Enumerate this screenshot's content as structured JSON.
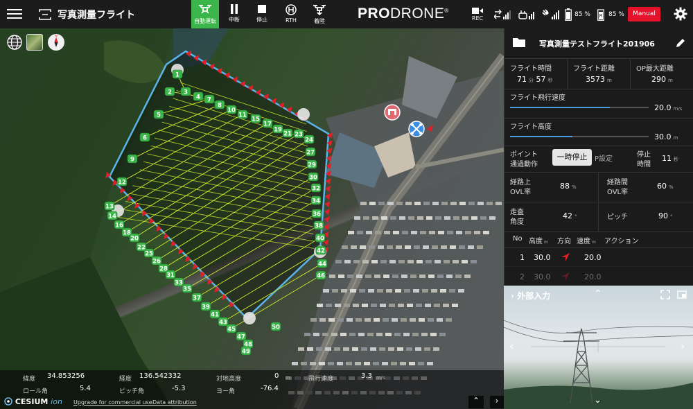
{
  "app": {
    "title": "写真測量フライト",
    "brand_bold": "PRO",
    "brand_rest": "DRONE",
    "brand_mark": "®"
  },
  "toolbar": {
    "auto_label": "自動運転",
    "pause_label": "中断",
    "stop_label": "停止",
    "rth_label": "RTH",
    "land_label": "着陸"
  },
  "status": {
    "rec_label": "REC",
    "battery1": "85 %",
    "battery2": "85 %",
    "manual_label": "Manual"
  },
  "map": {
    "compass_letter": "N",
    "waypoints": [
      "1",
      "2",
      "3",
      "4",
      "5",
      "6",
      "7",
      "8",
      "9",
      "10",
      "11",
      "12",
      "13",
      "14",
      "15",
      "16",
      "17",
      "18",
      "19",
      "20",
      "21",
      "22",
      "23",
      "24",
      "25",
      "26",
      "27",
      "28",
      "29",
      "30",
      "31",
      "32",
      "33",
      "34",
      "35",
      "36",
      "37",
      "38",
      "39",
      "40",
      "41",
      "42",
      "43",
      "44",
      "45",
      "46",
      "47",
      "48",
      "49",
      "50"
    ],
    "info": {
      "lat_label": "緯度",
      "lat_value": "34.853256",
      "lon_label": "経度",
      "lon_value": "136.542332",
      "alt_label": "対地高度",
      "alt_value": "0",
      "alt_unit": "m",
      "speed_label": "飛行速度",
      "speed_value": "3.3",
      "speed_unit": "m/s",
      "roll_label": "ロール角",
      "roll_value": "5.4",
      "pitch_label": "ピッチ角",
      "pitch_value": "-5.3",
      "yaw_label": "ヨー角",
      "yaw_value": "-76.4"
    },
    "cesium_main": "CESIUM",
    "cesium_ion": "ion",
    "upgrade_link": "Upgrade for commercial use.",
    "attribution_link": "Data attribution"
  },
  "panel": {
    "flight_name": "写真測量テストフライト201906",
    "flight_time_label": "フライト時間",
    "flight_time_min": "71",
    "flight_time_min_unit": "分",
    "flight_time_sec": "57",
    "flight_time_sec_unit": "秒",
    "flight_dist_label": "フライト距離",
    "flight_dist_value": "3573",
    "flight_dist_unit": "m",
    "op_max_label": "OP最大距離",
    "op_max_value": "290",
    "op_max_unit": "m",
    "speed_label": "フライト飛行速度",
    "speed_value": "20.0",
    "speed_unit": "m/s",
    "speed_fill": 0.72,
    "height_label": "フライト高度",
    "height_value": "30.0",
    "height_unit": "m",
    "height_fill": 0.45,
    "point_action_label1": "ポイント",
    "point_action_label2": "通過動作",
    "pause_btn": "一時停止",
    "pset_btn": "P設定",
    "stop_time_label1": "停止",
    "stop_time_label2": "時間",
    "stop_time_value": "11",
    "stop_time_unit": "秒",
    "ovl_on_label1": "経路上",
    "ovl_on_label2": "OVL率",
    "ovl_on_value": "88",
    "ovl_on_unit": "%",
    "ovl_between_label1": "経路間",
    "ovl_between_label2": "OVL率",
    "ovl_between_value": "60",
    "ovl_between_unit": "%",
    "scan_angle_label1": "走査",
    "scan_angle_label2": "角度",
    "scan_angle_value": "42",
    "scan_angle_unit": "°",
    "pitch_label": "ピッチ",
    "pitch_value": "90",
    "pitch_unit": "°",
    "table": {
      "col_no": "No",
      "col_alt": "高度",
      "col_alt_unit": "m",
      "col_dir": "方向",
      "col_speed": "速度",
      "col_speed_unit": "m",
      "col_action": "アクション",
      "rows": [
        {
          "no": "1",
          "alt": "30.0",
          "speed": "20.0"
        },
        {
          "no": "2",
          "alt": "30.0",
          "speed": "20.0"
        }
      ]
    }
  },
  "external": {
    "title": "外部入力"
  },
  "colors": {
    "accent_green": "#3cb54a",
    "manual_red": "#e4122a",
    "route_line": "#c8e22a",
    "boundary": "#5ab4ea",
    "arrow_red": "#e0202a"
  }
}
